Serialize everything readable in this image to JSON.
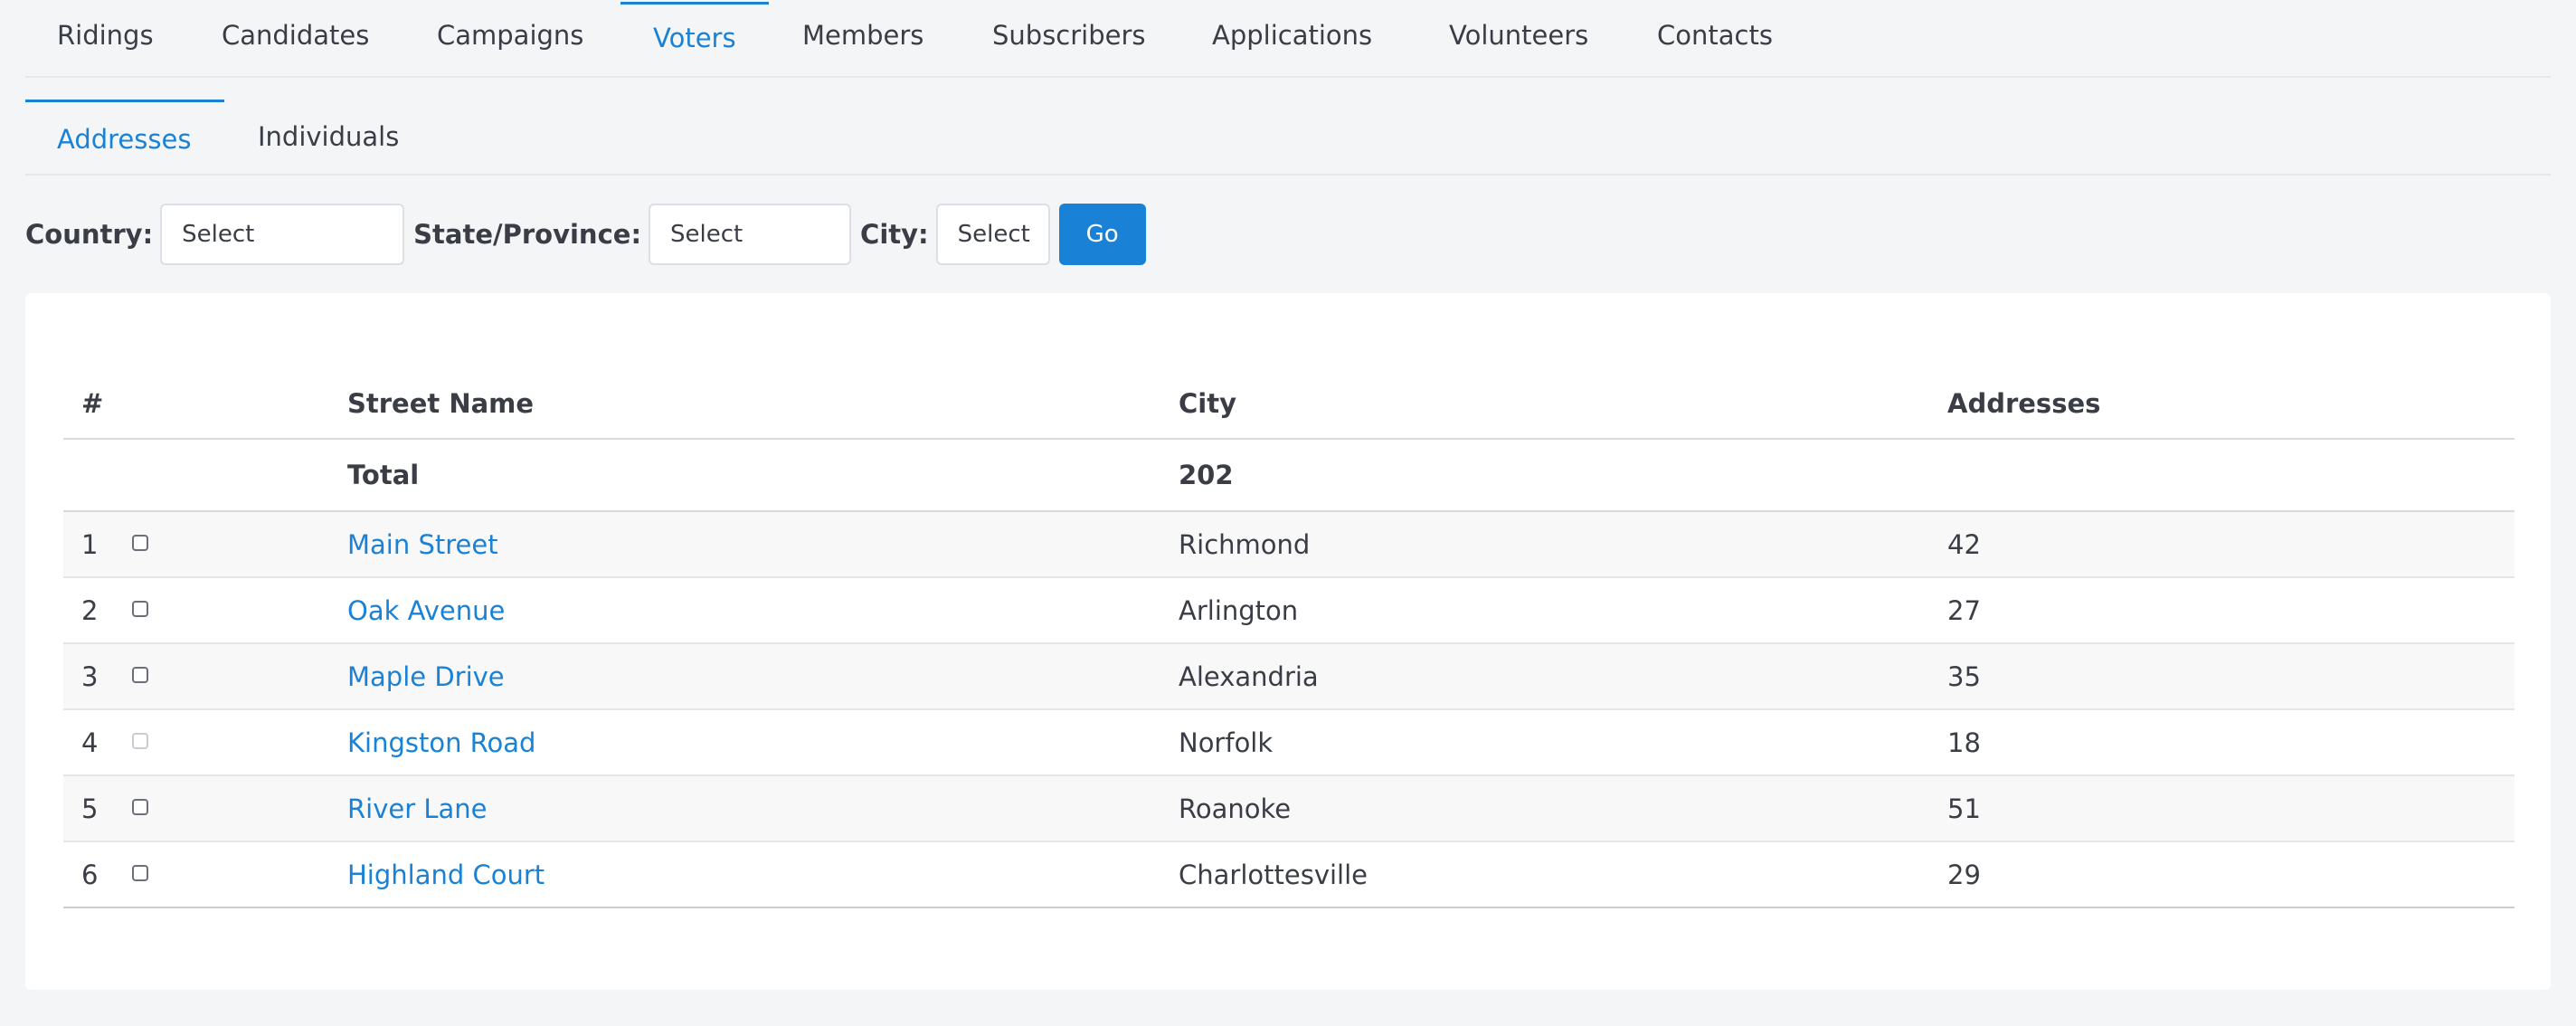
{
  "top_nav": {
    "tabs": [
      {
        "label": "Ridings",
        "active": false
      },
      {
        "label": "Candidates",
        "active": false
      },
      {
        "label": "Campaigns",
        "active": false
      },
      {
        "label": "Voters",
        "active": true
      },
      {
        "label": "Members",
        "active": false
      },
      {
        "label": "Subscribers",
        "active": false
      },
      {
        "label": "Applications",
        "active": false
      },
      {
        "label": "Volunteers",
        "active": false
      },
      {
        "label": "Contacts",
        "active": false
      }
    ]
  },
  "sub_nav": {
    "tabs": [
      {
        "label": "Addresses",
        "active": true
      },
      {
        "label": "Individuals",
        "active": false
      }
    ]
  },
  "filters": {
    "country_label": "Country:",
    "country_value": "Select",
    "state_label": "State/Province:",
    "state_value": "Select",
    "city_label": "City:",
    "city_value": "Select",
    "go_label": "Go"
  },
  "table": {
    "headers": {
      "num": "#",
      "street": "Street Name",
      "city": "City",
      "addresses": "Addresses"
    },
    "total": {
      "label": "Total",
      "value": "202"
    },
    "rows": [
      {
        "num": "1",
        "street": "Main Street",
        "city": "Richmond",
        "addresses": "42",
        "checkbox_enabled": true
      },
      {
        "num": "2",
        "street": "Oak Avenue",
        "city": "Arlington",
        "addresses": "27",
        "checkbox_enabled": true
      },
      {
        "num": "3",
        "street": "Maple Drive",
        "city": "Alexandria",
        "addresses": "35",
        "checkbox_enabled": true
      },
      {
        "num": "4",
        "street": "Kingston Road",
        "city": "Norfolk",
        "addresses": "18",
        "checkbox_enabled": false
      },
      {
        "num": "5",
        "street": "River Lane",
        "city": "Roanoke",
        "addresses": "51",
        "checkbox_enabled": true
      },
      {
        "num": "6",
        "street": "Highland Court",
        "city": "Charlottesville",
        "addresses": "29",
        "checkbox_enabled": true
      }
    ]
  },
  "colors": {
    "accent": "#1a82d6",
    "text": "#3a3d45",
    "background": "#f4f5f7",
    "card": "#ffffff"
  }
}
